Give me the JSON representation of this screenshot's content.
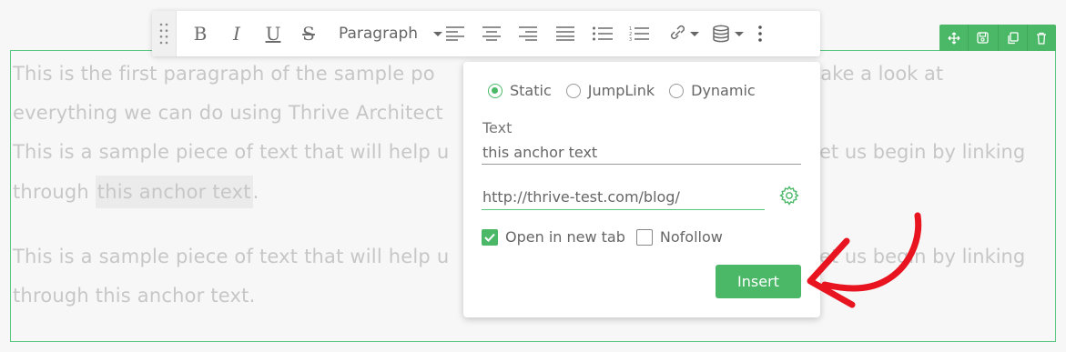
{
  "content": {
    "p1_line1": "This is the first paragraph of the sample po",
    "p1_line1_tail": "take a look at",
    "p1_line2": "everything we can do using Thrive Architect",
    "p2_line1": "This is a sample piece of text that will help u",
    "p2_line1_tail": "et us begin by linking",
    "p2_line2_prefix": "through ",
    "p2_anchor": "this anchor text",
    "p2_line2_suffix": ".",
    "p3_line1": "This is a sample piece of text that will help u",
    "p3_line1_tail": "et us begin by linking",
    "p3_line2": "through this anchor text."
  },
  "toolbar": {
    "bold": "B",
    "italic": "I",
    "underline": "U",
    "strikethrough": "S",
    "paragraph_select": "Paragraph"
  },
  "link_popup": {
    "radio_options": [
      "Static",
      "JumpLink",
      "Dynamic"
    ],
    "selected_option": "Static",
    "text_label": "Text",
    "text_value": "this anchor text",
    "url_value": "http://thrive-test.com/blog/",
    "open_new_tab_label": "Open in new tab",
    "open_new_tab_checked": true,
    "nofollow_label": "Nofollow",
    "nofollow_checked": false,
    "insert_label": "Insert"
  },
  "colors": {
    "accent": "#4bb868",
    "arrow": "#e8141f"
  },
  "icons": [
    "drag-handle-icon",
    "align-left-icon",
    "align-center-icon",
    "align-right-icon",
    "align-justify-icon",
    "bullet-list-icon",
    "numbered-list-icon",
    "link-icon",
    "database-icon",
    "more-vertical-icon",
    "move-icon",
    "save-icon",
    "duplicate-icon",
    "delete-icon",
    "gear-icon",
    "checkmark-icon"
  ]
}
